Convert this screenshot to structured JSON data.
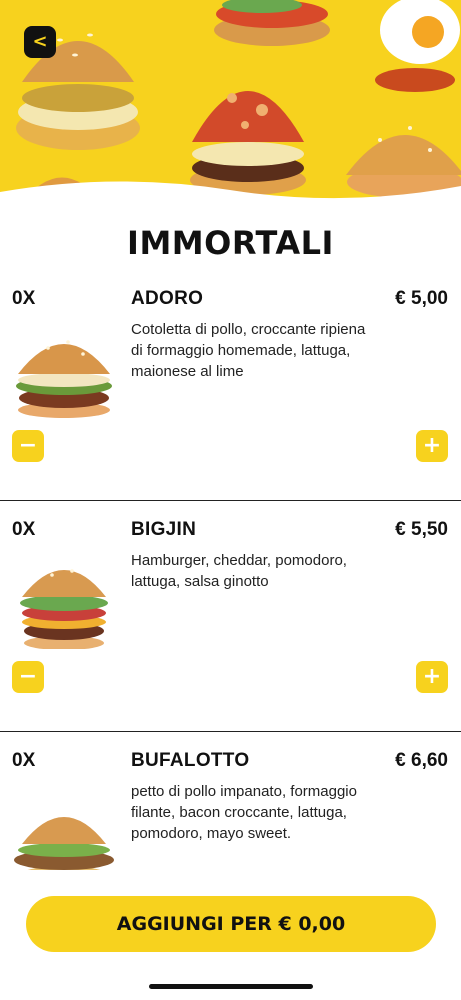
{
  "header": {
    "back_icon": "chevron-left-icon",
    "back_glyph": "<",
    "brand_color": "#f7d21e"
  },
  "section": {
    "title": "IMMORTALI"
  },
  "items": [
    {
      "qty": "0X",
      "name": "ADORO",
      "price": "€ 5,00",
      "description": "Cotoletta di pollo, croccante ripiena di formaggio homemade,  lattuga, maionese al lime",
      "minus": "−",
      "plus": "+"
    },
    {
      "qty": "0X",
      "name": "BIGJIN",
      "price": "€ 5,50",
      "description": "Hamburger,  cheddar, pomodoro,  lattuga,  salsa ginotto",
      "minus": "−",
      "plus": "+"
    },
    {
      "qty": "0X",
      "name": "BUFALOTTO",
      "price": "€ 6,60",
      "description": "petto di pollo impanato, formaggio filante, bacon croccante,  lattuga, pomodoro, mayo sweet."
    }
  ],
  "cta": {
    "label": "AGGIUNGI PER € 0,00"
  }
}
